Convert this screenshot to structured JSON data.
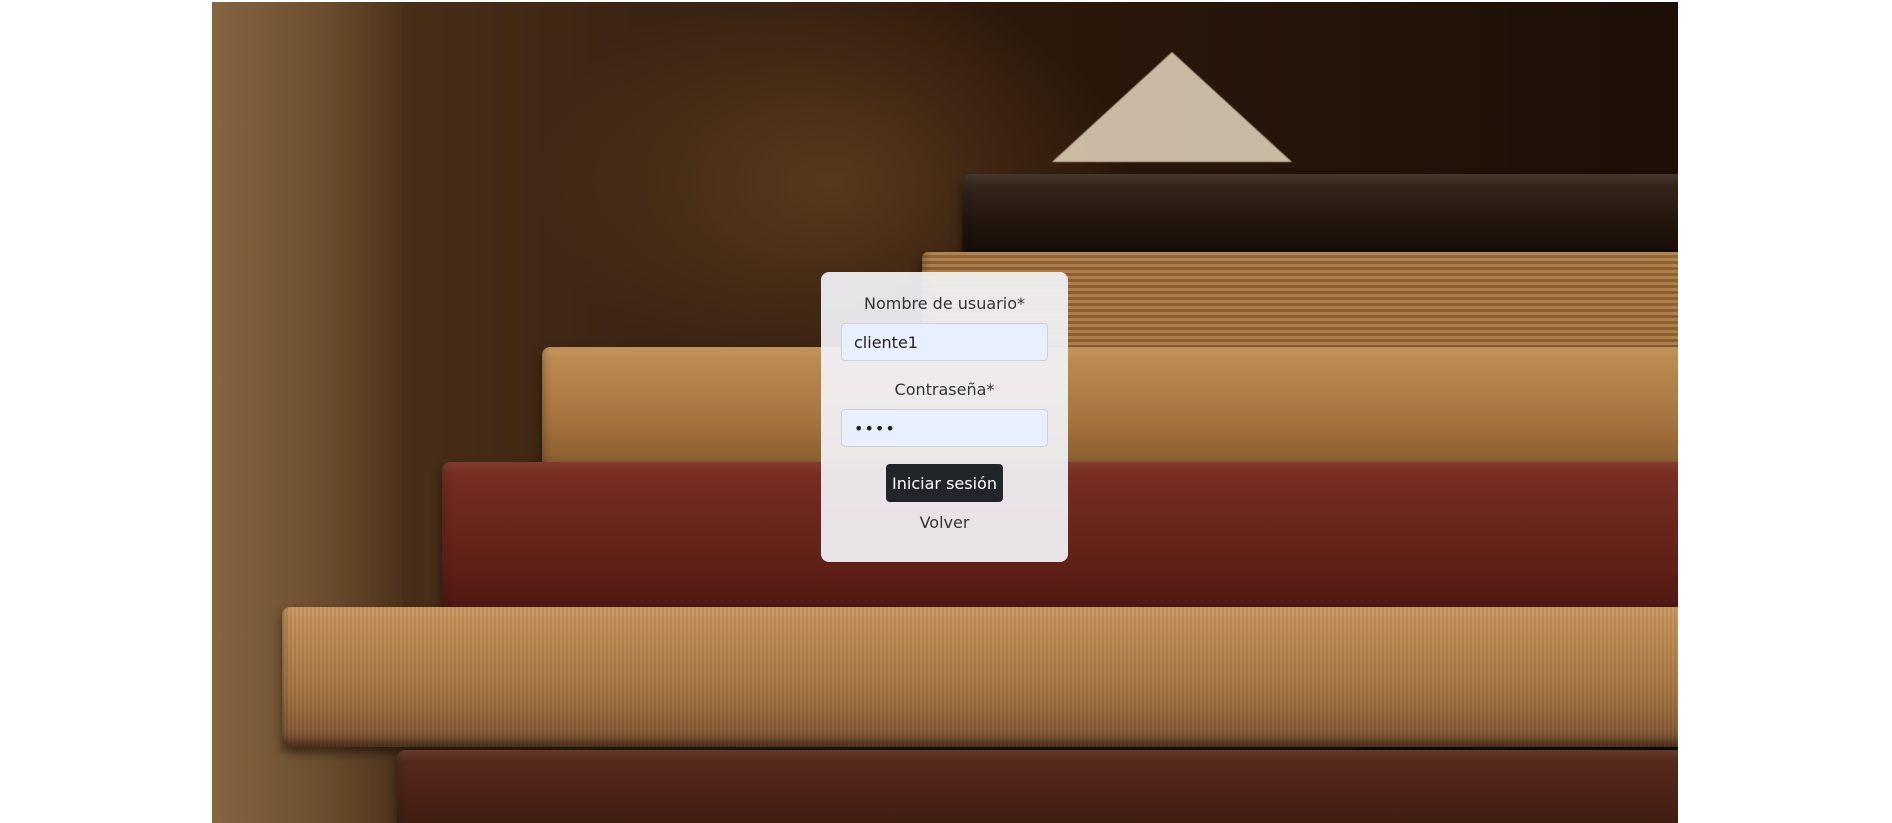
{
  "background": {
    "description_icon": "books-photo"
  },
  "login": {
    "username_label": "Nombre de usuario*",
    "username_value": "cliente1",
    "password_label": "Contraseña*",
    "password_value": "••••",
    "submit_label": "Iniciar sesión",
    "back_label": "Volver"
  },
  "colors": {
    "button_bg": "#212529",
    "input_bg": "#e8f0fe",
    "card_bg": "#f2f2f6"
  }
}
